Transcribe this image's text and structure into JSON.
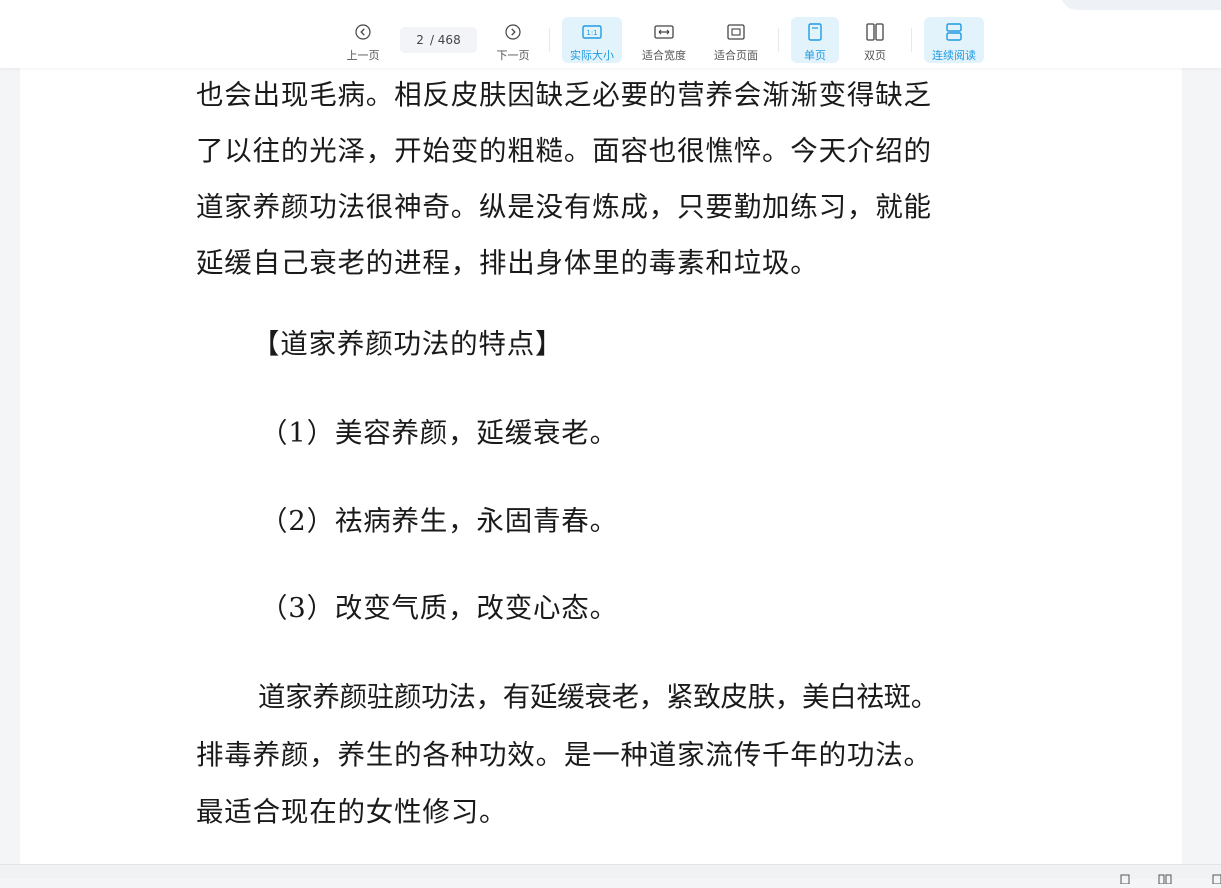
{
  "toolbar": {
    "prev_label": "上一页",
    "current_page": "2",
    "total_pages": "/ 468",
    "next_label": "下一页",
    "actual_size_label": "实际大小",
    "actual_size_glyph": "1:1",
    "fit_width_label": "适合宽度",
    "fit_page_label": "适合页面",
    "single_page_label": "单页",
    "double_page_label": "双页",
    "continuous_label": "连续阅读",
    "accent_color": "#1e9be0"
  },
  "document": {
    "lines": [
      "也会出现毛病。相反皮肤因缺乏必要的营养会渐渐变得缺乏",
      "了以往的光泽，开始变的粗糙。面容也很憔悴。今天介绍的",
      "道家养颜功法很神奇。纵是没有炼成，只要勤加练习，就能",
      "延缓自己衰老的进程，排出身体里的毒素和垃圾。",
      "【道家养颜功法的特点】",
      "（1）美容养颜，延缓衰老。",
      "（2）祛病养生，永固青春。",
      "（3）改变气质，改变心态。",
      "道家养颜驻颜功法，有延缓衰老，紧致皮肤，美白祛斑。",
      "排毒养颜，养生的各种功效。是一种道家流传千年的功法。",
      "最适合现在的女性修习。"
    ]
  }
}
